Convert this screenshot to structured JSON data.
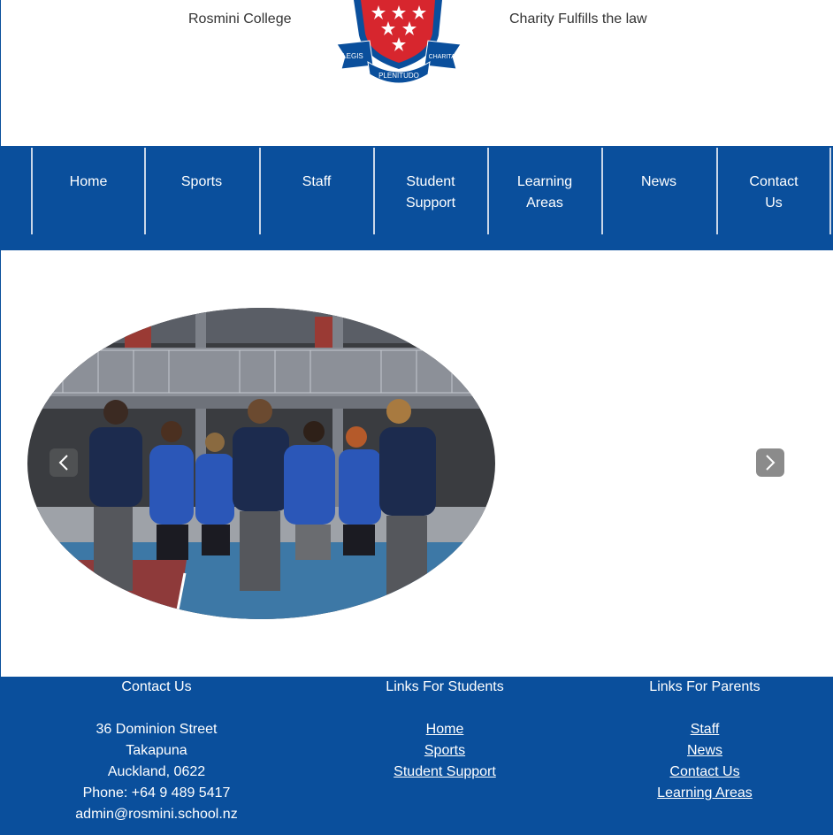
{
  "header": {
    "college_name": "Rosmini College",
    "motto": "Charity Fulfills the law",
    "crest": {
      "ribbon_left": "LEGIS",
      "ribbon_right": "CHARITAS",
      "ribbon_bottom": "PLENITUDO"
    }
  },
  "nav": {
    "items": [
      {
        "line1": "Home",
        "line2": ""
      },
      {
        "line1": "Sports",
        "line2": ""
      },
      {
        "line1": "Staff",
        "line2": ""
      },
      {
        "line1": "Student",
        "line2": "Support"
      },
      {
        "line1": "Learning",
        "line2": "Areas"
      },
      {
        "line1": "News",
        "line2": ""
      },
      {
        "line1": "Contact",
        "line2": "Us"
      }
    ]
  },
  "slider": {
    "prev_icon": "chevron-left-icon",
    "next_icon": "chevron-right-icon"
  },
  "footer": {
    "contact": {
      "heading": "Contact Us",
      "street": "36 Dominion Street",
      "suburb": "Takapuna",
      "city": "Auckland, 0622",
      "phone": "Phone: +64 9 489 5417",
      "email": "admin@rosmini.school.nz"
    },
    "students": {
      "heading": "Links For Students",
      "links": [
        "Home",
        "Sports",
        "Student Support"
      ]
    },
    "parents": {
      "heading": "Links For Parents",
      "links": [
        "Staff",
        "News",
        "Contact Us",
        "Learning Areas"
      ]
    }
  },
  "colors": {
    "brand_blue": "#0a4f9c",
    "crest_red": "#d7262e",
    "white": "#ffffff"
  }
}
